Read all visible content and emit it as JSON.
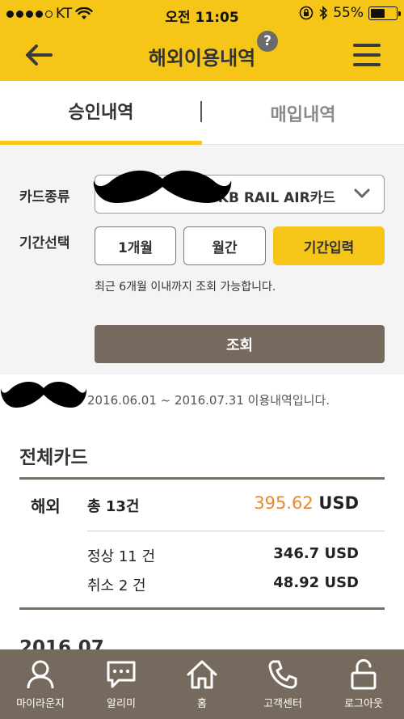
{
  "status_bar": {
    "carrier": "KT",
    "time": "오전 11:05",
    "battery": "55%",
    "battery_level": 0.55
  },
  "header": {
    "title": "해외이용내역",
    "help": "?"
  },
  "tabs": [
    {
      "label": "승인내역",
      "active": true
    },
    {
      "label": "매입내역",
      "active": false
    }
  ],
  "filter": {
    "card_type_label": "카드종류",
    "card_selected": "KB RAIL AIR카드",
    "period_label": "기간선택",
    "period_options": [
      "1개월",
      "월간",
      "기간입력"
    ],
    "period_selected": "기간입력",
    "hint": "최근 6개월 이내까지 조회 가능합니다.",
    "search_button": "조회"
  },
  "results": {
    "period_text": "2016.06.01 ~ 2016.07.31 이용내역입니다.",
    "section_title": "전체카드",
    "overseas_label": "해외",
    "total_count": "총 13건",
    "total_amount": "395.62",
    "currency": "USD",
    "normal_label": "정상 11 건",
    "normal_amount": "346.7 USD",
    "cancel_label": "취소 2 건",
    "cancel_amount": "48.92 USD",
    "next_month": "2016.07"
  },
  "bottom_nav": [
    {
      "label": "마이라운지",
      "icon": "person-icon"
    },
    {
      "label": "알리미",
      "icon": "chat-bubble-icon"
    },
    {
      "label": "홈",
      "icon": "home-icon"
    },
    {
      "label": "고객센터",
      "icon": "phone-icon"
    },
    {
      "label": "로그아웃",
      "icon": "unlock-icon"
    }
  ],
  "colors": {
    "brand_yellow": "#f5c518",
    "brown": "#756a5d",
    "accent_orange": "#e8892b"
  }
}
